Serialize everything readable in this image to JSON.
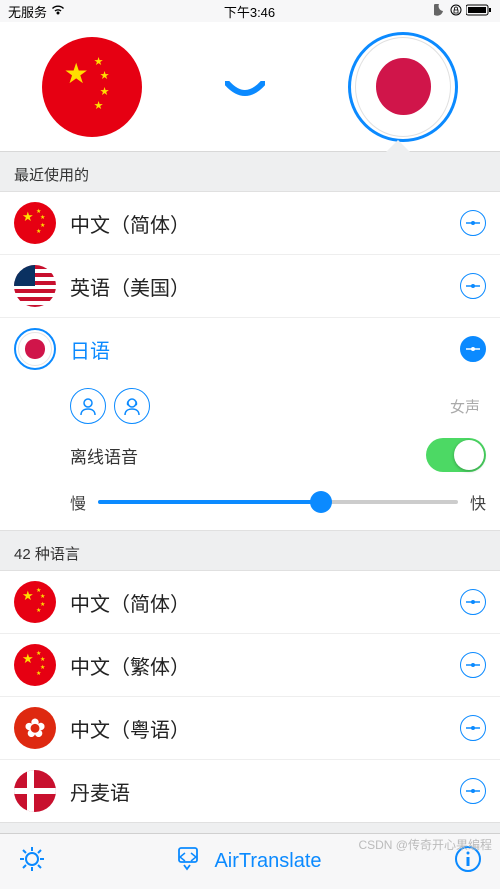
{
  "status": {
    "carrier": "无服务",
    "time": "下午3:46"
  },
  "header": {
    "source_flag": "cn",
    "target_flag": "jp",
    "selected": "target"
  },
  "sections": {
    "recent": {
      "title": "最近使用的",
      "items": [
        {
          "flag": "cn",
          "label": "中文（简体）",
          "selected": false
        },
        {
          "flag": "us",
          "label": "英语（美国）",
          "selected": false
        },
        {
          "flag": "jp",
          "label": "日语",
          "selected": true
        }
      ]
    },
    "expanded": {
      "voice_label": "女声",
      "offline_label": "离线语音",
      "offline_on": true,
      "speed_min": "慢",
      "speed_max": "快",
      "speed_pct": 62
    },
    "all": {
      "title": "42 种语言",
      "items": [
        {
          "flag": "cn",
          "label": "中文（简体）"
        },
        {
          "flag": "cn",
          "label": "中文（繁体）"
        },
        {
          "flag": "hk",
          "label": "中文（粤语）"
        },
        {
          "flag": "dk",
          "label": "丹麦语"
        }
      ]
    }
  },
  "bottom": {
    "app_name": "AirTranslate"
  },
  "watermark": "CSDN @传奇开心果编程"
}
